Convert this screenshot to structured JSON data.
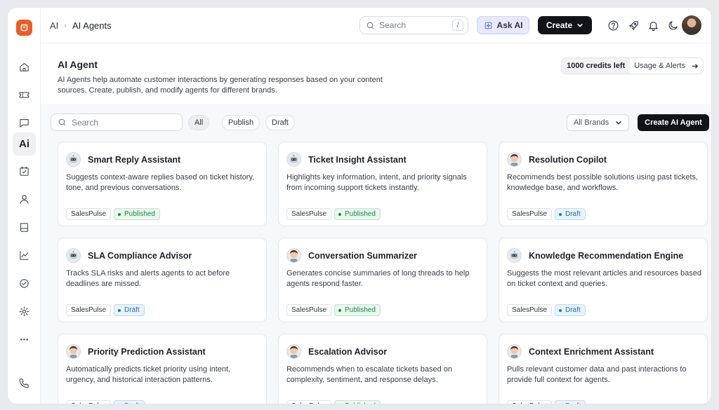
{
  "breadcrumb": {
    "root": "AI",
    "current": "AI Agents"
  },
  "topbar": {
    "search_placeholder": "Search",
    "search_shortcut": "/",
    "ask_ai_label": "Ask AI",
    "create_label": "Create"
  },
  "sidebar": {
    "items": [
      {
        "name": "home",
        "icon": "home-icon"
      },
      {
        "name": "tickets",
        "icon": "ticket-icon"
      },
      {
        "name": "chat",
        "icon": "chat-icon"
      },
      {
        "name": "ai",
        "icon": "ai-icon",
        "label": "Ai",
        "active": true
      },
      {
        "name": "tasks",
        "icon": "calendar-check-icon"
      },
      {
        "name": "contacts",
        "icon": "user-icon"
      },
      {
        "name": "knowledge-base",
        "icon": "book-icon"
      },
      {
        "name": "reports",
        "icon": "chart-icon"
      },
      {
        "name": "sla",
        "icon": "check-circle-icon"
      },
      {
        "name": "settings",
        "icon": "gear-icon"
      },
      {
        "name": "more",
        "icon": "more-icon"
      },
      {
        "name": "phone",
        "icon": "phone-icon"
      }
    ]
  },
  "header": {
    "title": "AI Agent",
    "description": "AI Agents help automate customer interactions by generating responses based on your content sources. Create, publish, and modify agents for different brands.",
    "credits": "1000 credits left",
    "usage_link": "Usage & Alerts"
  },
  "filters": {
    "search_placeholder": "Search",
    "tabs": [
      "All",
      "Publish",
      "Draft"
    ],
    "active_tab": "All",
    "brands_label": "All Brands",
    "create_agent_label": "Create AI Agent"
  },
  "colors": {
    "accent": "#f25a24",
    "published": "#1f8a4c",
    "draft": "#1d73b8",
    "primary_button": "#111317"
  },
  "agents": [
    {
      "name": "Smart Reply Assistant",
      "description": "Suggests context-aware replies based on ticket history, tone, and previous conversations.",
      "brand": "SalesPulse",
      "status": "Published",
      "avatar": "robot"
    },
    {
      "name": "Ticket Insight Assistant",
      "description": "Highlights key information, intent, and priority signals from incoming support tickets instantly.",
      "brand": "SalesPulse",
      "status": "Published",
      "avatar": "robot"
    },
    {
      "name": "Resolution Copilot",
      "description": "Recommends best possible solutions using past tickets, knowledge base, and workflows.",
      "brand": "SalesPulse",
      "status": "Draft",
      "avatar": "person"
    },
    {
      "name": "SLA Compliance Advisor",
      "description": "Tracks SLA risks and alerts agents to act before deadlines are missed.",
      "brand": "SalesPulse",
      "status": "Draft",
      "avatar": "robot"
    },
    {
      "name": "Conversation Summarizer",
      "description": "Generates concise summaries of long threads to help agents respond faster.",
      "brand": "SalesPulse",
      "status": "Published",
      "avatar": "person"
    },
    {
      "name": "Knowledge Recommendation Engine",
      "description": "Suggests the most relevant articles and resources based on ticket context and queries.",
      "brand": "SalesPulse",
      "status": "Draft",
      "avatar": "robot"
    },
    {
      "name": "Priority Prediction Assistant",
      "description": "Automatically predicts ticket priority using intent, urgency, and historical interaction patterns.",
      "brand": "SalesPulse",
      "status": "Draft",
      "avatar": "person"
    },
    {
      "name": "Escalation Advisor",
      "description": "Recommends when to escalate tickets based on complexity, sentiment, and response delays.",
      "brand": "SalesPulse",
      "status": "Published",
      "avatar": "person"
    },
    {
      "name": "Context Enrichment Assistant",
      "description": "Pulls relevant customer data and past interactions to provide full context for agents.",
      "brand": "SalesPulse",
      "status": "Draft",
      "avatar": "person"
    }
  ]
}
